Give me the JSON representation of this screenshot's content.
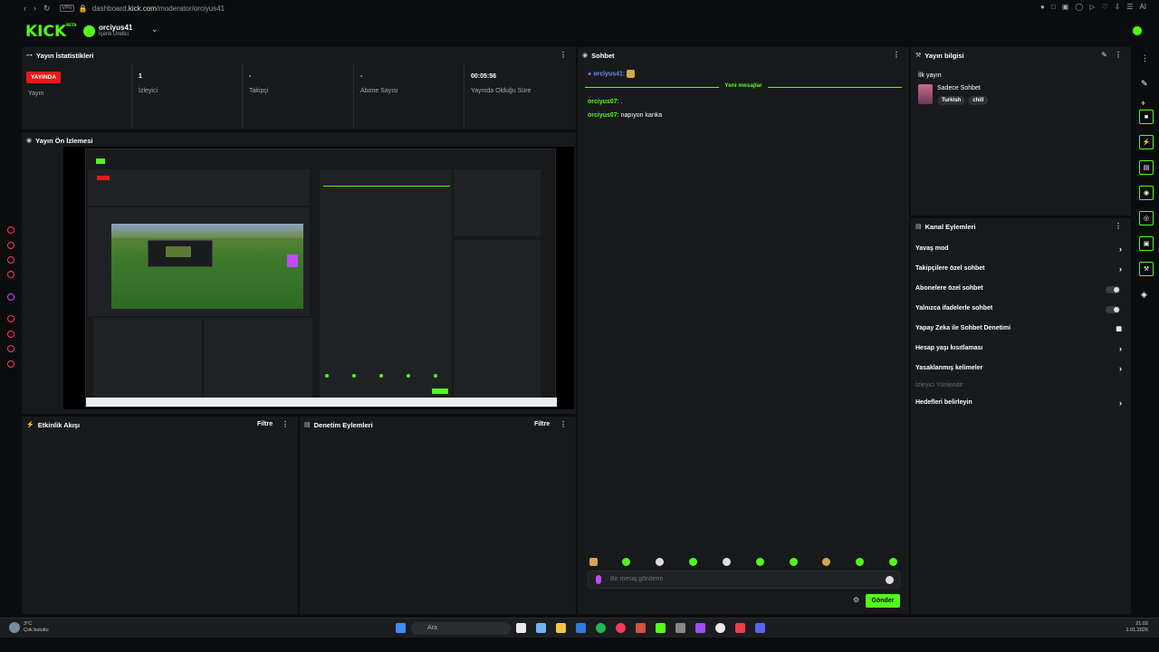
{
  "browser": {
    "url_prefix": "dashboard.",
    "url_host": "kick.com",
    "url_path": "/moderator/orciyus41",
    "badge": "VPN"
  },
  "header": {
    "logo": "KICK",
    "logo_sup": "BETA",
    "channel_name": "orciyus41",
    "channel_role": "İçerik Üretici"
  },
  "stats": {
    "title": "Yayın İstatistikleri",
    "live_badge": "YAYINDA",
    "live_label": "Yayın",
    "viewers_value": "1",
    "viewers_label": "İzleyici",
    "followers_value": "-",
    "followers_label": "Takipçi",
    "subs_value": "-",
    "subs_label": "Abone Sayısı",
    "uptime_value": "00:05:56",
    "uptime_label": "Yayında Olduğu Süre"
  },
  "preview": {
    "title": "Yayın Ön İzlemesi"
  },
  "activity": {
    "title": "Etkinlik Akışı",
    "filter": "Filtre"
  },
  "moderation": {
    "title": "Denetim Eylemleri",
    "filter": "Filtre"
  },
  "chat": {
    "title": "Sohbet",
    "messages": [
      {
        "user": "orciyus41",
        "text": ""
      },
      {
        "user": "orciyus07",
        "text": "."
      },
      {
        "user": "orciyus07",
        "text": "napıyon kanka"
      }
    ],
    "new_messages": "Yeni mesajlar",
    "input_placeholder": "Bir mesaj gönderin",
    "send_label": "Gönder"
  },
  "stream_info": {
    "title": "Yayın bilgisi",
    "stream_title": "İlk yayın",
    "category": "Sadece Sohbet",
    "tags": [
      "Turkish",
      "chill"
    ]
  },
  "channel_actions": {
    "title": "Kanal Eylemleri",
    "items": [
      "Yavaş mod",
      "Takipçilere özel sohbet",
      "Abonelere özel sohbet",
      "Yalnızca ifadelerle sohbet",
      "Yapay Zeka ile Sohbet Denetimi",
      "Hesap yaşı kısıtlaması",
      "Yasaklanmış kelimeler",
      "İzleyici Yönlendir",
      "Hedefleri belirleyin"
    ]
  },
  "taskbar": {
    "weather_temp": "3°C",
    "weather_text": "Çok bulutlu",
    "search": "Ara",
    "time": "21:02",
    "date": "1.01.2026"
  },
  "colors": {
    "accent": "#53fc18",
    "live": "#e91916",
    "panel": "#18191b"
  }
}
